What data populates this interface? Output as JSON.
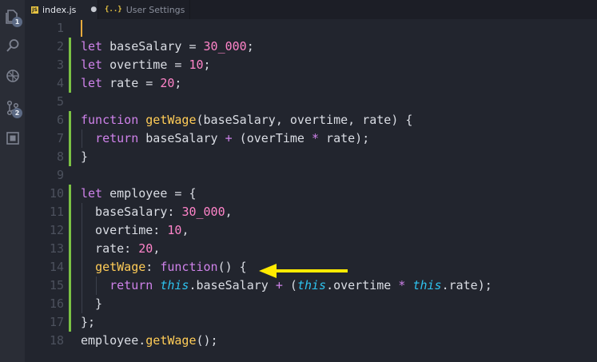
{
  "activity_bar": {
    "items": [
      {
        "icon": "files-icon",
        "badge": "1"
      },
      {
        "icon": "search-icon",
        "badge": ""
      },
      {
        "icon": "debug-icon",
        "badge": ""
      },
      {
        "icon": "source-control-icon",
        "badge": "2"
      },
      {
        "icon": "extensions-icon",
        "badge": ""
      }
    ]
  },
  "tabs": [
    {
      "label": "index.js",
      "icon": "js-file-icon",
      "icon_text": "JS",
      "dirty": "●",
      "active": true
    },
    {
      "label": "User Settings",
      "icon": "json-braces-icon",
      "icon_text": "{..}",
      "active": false
    }
  ],
  "colors": {
    "keyword": "#cf82ea",
    "function": "#ffcc57",
    "number": "#ff84c9",
    "this": "#2ec2ee",
    "plain": "#dadde4",
    "git_added": "#7bc244",
    "arrow": "#ffea00"
  },
  "editor": {
    "lines": [
      {
        "n": "1",
        "tokens": []
      },
      {
        "n": "2",
        "tokens": [
          {
            "t": "let",
            "c": "kw"
          },
          {
            "t": " baseSalary = ",
            "c": "p"
          },
          {
            "t": "30_000",
            "c": "num"
          },
          {
            "t": ";",
            "c": "p"
          }
        ]
      },
      {
        "n": "3",
        "tokens": [
          {
            "t": "let",
            "c": "kw"
          },
          {
            "t": " overtime = ",
            "c": "p"
          },
          {
            "t": "10",
            "c": "num"
          },
          {
            "t": ";",
            "c": "p"
          }
        ]
      },
      {
        "n": "4",
        "tokens": [
          {
            "t": "let",
            "c": "kw"
          },
          {
            "t": " rate = ",
            "c": "p"
          },
          {
            "t": "20",
            "c": "num"
          },
          {
            "t": ";",
            "c": "p"
          }
        ]
      },
      {
        "n": "5",
        "tokens": []
      },
      {
        "n": "6",
        "tokens": [
          {
            "t": "function",
            "c": "kw"
          },
          {
            "t": " ",
            "c": "p"
          },
          {
            "t": "getWage",
            "c": "fn"
          },
          {
            "t": "(baseSalary, overtime, rate) {",
            "c": "p"
          }
        ]
      },
      {
        "n": "7",
        "tokens": [
          {
            "t": "  ",
            "c": "p"
          },
          {
            "t": "return",
            "c": "kw"
          },
          {
            "t": " baseSalary ",
            "c": "p"
          },
          {
            "t": "+",
            "c": "kw"
          },
          {
            "t": " (overTime ",
            "c": "p"
          },
          {
            "t": "*",
            "c": "kw"
          },
          {
            "t": " rate);",
            "c": "p"
          }
        ]
      },
      {
        "n": "8",
        "tokens": [
          {
            "t": "}",
            "c": "p"
          }
        ]
      },
      {
        "n": "9",
        "tokens": []
      },
      {
        "n": "10",
        "tokens": [
          {
            "t": "let",
            "c": "kw"
          },
          {
            "t": " employee = {",
            "c": "p"
          }
        ]
      },
      {
        "n": "11",
        "tokens": [
          {
            "t": "  baseSalary: ",
            "c": "p"
          },
          {
            "t": "30_000",
            "c": "num"
          },
          {
            "t": ",",
            "c": "p"
          }
        ]
      },
      {
        "n": "12",
        "tokens": [
          {
            "t": "  overtime: ",
            "c": "p"
          },
          {
            "t": "10",
            "c": "num"
          },
          {
            "t": ",",
            "c": "p"
          }
        ]
      },
      {
        "n": "13",
        "tokens": [
          {
            "t": "  rate: ",
            "c": "p"
          },
          {
            "t": "20",
            "c": "num"
          },
          {
            "t": ",",
            "c": "p"
          }
        ]
      },
      {
        "n": "14",
        "tokens": [
          {
            "t": "  ",
            "c": "p"
          },
          {
            "t": "getWage",
            "c": "fn"
          },
          {
            "t": ": ",
            "c": "p"
          },
          {
            "t": "function",
            "c": "kw"
          },
          {
            "t": "() {",
            "c": "p"
          }
        ]
      },
      {
        "n": "15",
        "tokens": [
          {
            "t": "    ",
            "c": "p"
          },
          {
            "t": "return",
            "c": "kw"
          },
          {
            "t": " ",
            "c": "p"
          },
          {
            "t": "this",
            "c": "th"
          },
          {
            "t": ".baseSalary ",
            "c": "p"
          },
          {
            "t": "+",
            "c": "kw"
          },
          {
            "t": " (",
            "c": "p"
          },
          {
            "t": "this",
            "c": "th"
          },
          {
            "t": ".overtime ",
            "c": "p"
          },
          {
            "t": "*",
            "c": "kw"
          },
          {
            "t": " ",
            "c": "p"
          },
          {
            "t": "this",
            "c": "th"
          },
          {
            "t": ".rate);",
            "c": "p"
          }
        ]
      },
      {
        "n": "16",
        "tokens": [
          {
            "t": "  }",
            "c": "p"
          }
        ]
      },
      {
        "n": "17",
        "tokens": [
          {
            "t": "};",
            "c": "p"
          }
        ]
      },
      {
        "n": "18",
        "tokens": [
          {
            "t": "employee.",
            "c": "p"
          },
          {
            "t": "getWage",
            "c": "fn"
          },
          {
            "t": "();",
            "c": "p"
          }
        ]
      }
    ]
  }
}
